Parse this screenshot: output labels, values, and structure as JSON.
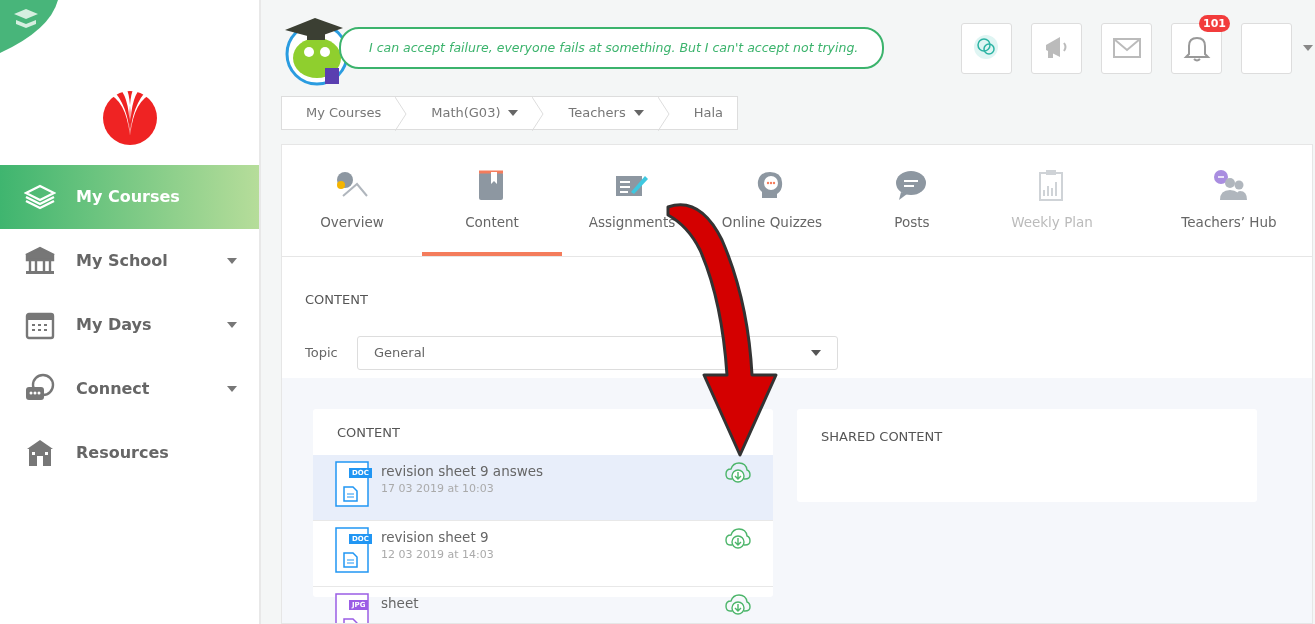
{
  "sidebar": {
    "items": [
      {
        "label": "My Courses",
        "selected": true,
        "has_menu": false
      },
      {
        "label": "My School",
        "selected": false,
        "has_menu": true
      },
      {
        "label": "My Days",
        "selected": false,
        "has_menu": true
      },
      {
        "label": "Connect",
        "selected": false,
        "has_menu": true
      },
      {
        "label": "Resources",
        "selected": false,
        "has_menu": false
      }
    ]
  },
  "quote": "I can accept failure, everyone fails at something. But I can't accept not trying.",
  "notifications": {
    "count": "101"
  },
  "breadcrumb": [
    {
      "label": "My Courses",
      "has_menu": false
    },
    {
      "label": "Math(G03)",
      "has_menu": true
    },
    {
      "label": "Teachers",
      "has_menu": true
    },
    {
      "label": "Hala",
      "has_menu": false
    }
  ],
  "tabs": [
    {
      "label": "Overview",
      "selected": false,
      "disabled": false
    },
    {
      "label": "Content",
      "selected": true,
      "disabled": false
    },
    {
      "label": "Assignments",
      "selected": false,
      "disabled": false
    },
    {
      "label": "Online Quizzes",
      "selected": false,
      "disabled": false
    },
    {
      "label": "Posts",
      "selected": false,
      "disabled": false
    },
    {
      "label": "Weekly Plan",
      "selected": false,
      "disabled": true
    },
    {
      "label": "Teachers’ Hub",
      "selected": false,
      "disabled": false
    }
  ],
  "section_title": "CONTENT",
  "topic": {
    "label": "Topic",
    "value": "General"
  },
  "content": {
    "title": "CONTENT",
    "items": [
      {
        "name": "revision sheet 9 answes",
        "date": "17 03 2019 at 10:03",
        "type": "DOC",
        "selected": true
      },
      {
        "name": "revision sheet 9",
        "date": "12 03 2019 at 14:03",
        "type": "DOC",
        "selected": false
      },
      {
        "name": "sheet",
        "type": "JPG",
        "selected": false
      }
    ]
  },
  "shared": {
    "title": "SHARED CONTENT"
  }
}
